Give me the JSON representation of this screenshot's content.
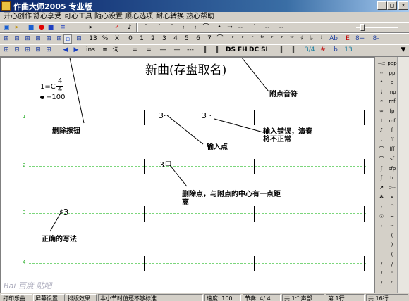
{
  "window": {
    "title": "作曲大师2005 专业版",
    "min": "_",
    "max": "□",
    "close": "×"
  },
  "menu": [
    "开心创作",
    "舒心享受",
    "可心工具",
    "随心设置",
    "顺心选项",
    "耐心转换",
    "热心帮助"
  ],
  "toolbar1": [
    "▣",
    "▸",
    "■",
    "●",
    "■",
    "≡",
    "▸",
    "✓",
    "♪",
    "˙",
    "˙",
    "˙",
    "⁝",
    "⁝",
    "⌒",
    "•",
    "→",
    "⌢",
    "˙",
    "⌢",
    "⌢"
  ],
  "toolbar2": [
    "⊞",
    "⊟",
    "⊞",
    "⊞",
    "⊞",
    "⊞",
    "▫",
    "⊟",
    "13",
    "%",
    "X",
    "0",
    "1",
    "2",
    "3",
    "4",
    "5",
    "6",
    "7",
    "⌒",
    "ʳ",
    "ʳ",
    "ʳ",
    "ᵗʳ",
    "ʳ",
    "ʳ",
    "ᵗʳ",
    "♯",
    "♭",
    "♮",
    "Ab",
    "E",
    "8+",
    "8-"
  ],
  "toolbar3": [
    "ins",
    "≡",
    "词",
    "=",
    "=",
    "—",
    "—",
    "---",
    "‖",
    "‖",
    "DS",
    "FH",
    "DC",
    "SI",
    "‖",
    "‖",
    "3/4",
    "#",
    "b",
    "13"
  ],
  "score": {
    "title": "新曲(存盘取名)",
    "key": "1=C",
    "time_top": "4",
    "time_bottom": "4",
    "tempo": "=100",
    "line_numbers": [
      "1",
      "2",
      "3",
      "4"
    ],
    "notes": {
      "n1": "3·",
      "n2": "3 ·",
      "n3": "3",
      "n3_dot": "□",
      "n4": "♯3"
    }
  },
  "callouts": {
    "dotted_note": "附点音符",
    "delete_button": "删除按钮",
    "input_dot": "输入点",
    "input_error": "输入错误，演奏",
    "input_error_2": "将不正常",
    "delete_dot": "删除点，与附点的中心有一点距",
    "delete_dot_2": "离",
    "correct_way": "正确的写法"
  },
  "watermark": "Bai 百度 贴吧",
  "palette": [
    "𝆒",
    "ppp",
    "𝄐",
    "pp",
    "𝄌",
    "p",
    "𝅘𝅥",
    "mp",
    "𝄎",
    "mf",
    "∞",
    "fp",
    "♩",
    "mf",
    "♪",
    "f",
    "𝅘",
    "ff",
    "⌒",
    "fff",
    "⌒",
    "sf",
    "ʃ",
    "sfp",
    "ʃ",
    "tr",
    "↗",
    "𝆓",
    "✻",
    "∨",
    "𝆕",
    "^",
    "☉",
    "~",
    "𝆔",
    "∽",
    "—",
    "(",
    "—",
    ")",
    "—",
    "(",
    "∕",
    "∕",
    "∕",
    "⁼",
    "∕",
    "ᵗ"
  ],
  "status": {
    "print": "打印乐曲",
    "screen": "屏幕设置",
    "typeset": "排版效果",
    "message": "本小节时值还不够标准",
    "tempo": "速度: 100",
    "beat": "节奏: 4/ 4",
    "voices": "共 1个声部",
    "row": "第 1行",
    "total": "共 16行"
  }
}
